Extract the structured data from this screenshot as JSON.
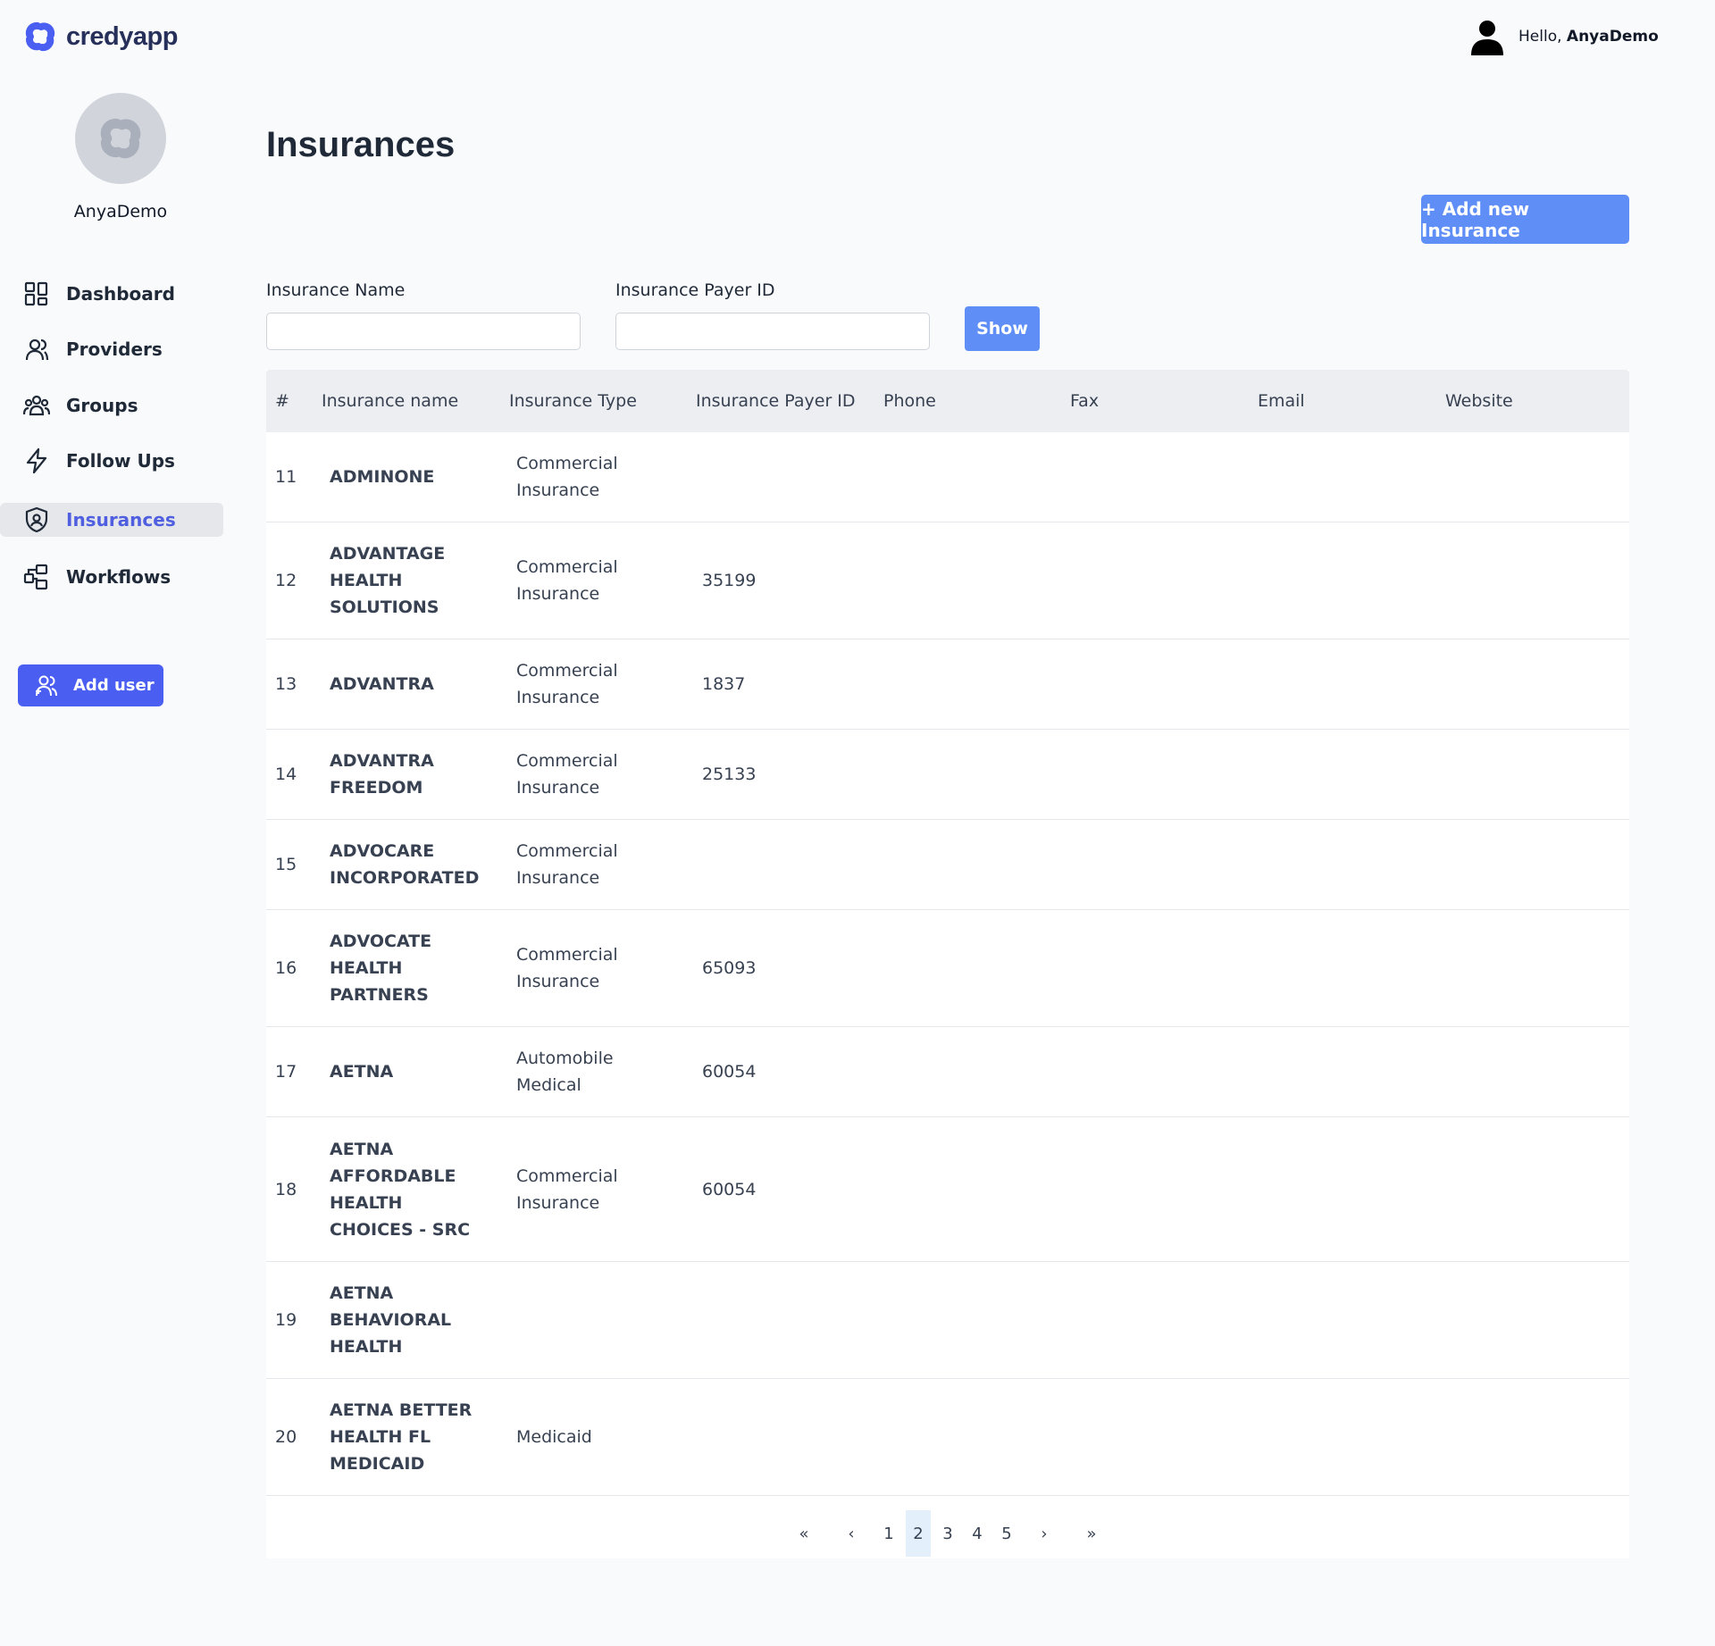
{
  "brand": {
    "name": "credyapp",
    "color": "#4a5ff2"
  },
  "top_user": {
    "greeting": "Hello,",
    "name": "AnyaDemo"
  },
  "profile": {
    "username": "AnyaDemo"
  },
  "nav": {
    "items": [
      {
        "label": "Dashboard",
        "icon": "dashboard-grid-icon",
        "active": false
      },
      {
        "label": "Providers",
        "icon": "user-icon",
        "active": false
      },
      {
        "label": "Groups",
        "icon": "group-icon",
        "active": false
      },
      {
        "label": "Follow Ups",
        "icon": "lightning-icon",
        "active": false
      },
      {
        "label": "Insurances",
        "icon": "shield-user-icon",
        "active": true
      },
      {
        "label": "Workflows",
        "icon": "workflow-icon",
        "active": false
      }
    ],
    "add_user_label": "Add user"
  },
  "page": {
    "title": "Insurances",
    "add_new_label": "+ Add new Insurance"
  },
  "filters": {
    "name_label": "Insurance Name",
    "name_value": "",
    "payer_label": "Insurance Payer ID",
    "payer_value": "",
    "show_label": "Show"
  },
  "table": {
    "columns": [
      "#",
      "Insurance name",
      "Insurance Type",
      "Insurance Payer ID",
      "Phone",
      "Fax",
      "Email",
      "Website"
    ],
    "rows": [
      {
        "num": "11",
        "name": "ADMINONE",
        "type": "Commercial Insurance",
        "payer": ""
      },
      {
        "num": "12",
        "name": "ADVANTAGE HEALTH SOLUTIONS",
        "type": "Commercial Insurance",
        "payer": "35199"
      },
      {
        "num": "13",
        "name": "ADVANTRA",
        "type": "Commercial Insurance",
        "payer": "1837"
      },
      {
        "num": "14",
        "name": "ADVANTRA FREEDOM",
        "type": "Commercial Insurance",
        "payer": "25133"
      },
      {
        "num": "15",
        "name": "ADVOCARE INCORPORATED",
        "type": "Commercial Insurance",
        "payer": ""
      },
      {
        "num": "16",
        "name": "ADVOCATE HEALTH PARTNERS",
        "type": "Commercial Insurance",
        "payer": "65093"
      },
      {
        "num": "17",
        "name": "AETNA",
        "type": "Automobile Medical",
        "payer": "60054"
      },
      {
        "num": "18",
        "name": "AETNA AFFORDABLE HEALTH CHOICES - SRC",
        "type": "Commercial Insurance",
        "payer": "60054"
      },
      {
        "num": "19",
        "name": "AETNA BEHAVIORAL HEALTH",
        "type": "",
        "payer": ""
      },
      {
        "num": "20",
        "name": "AETNA BETTER HEALTH FL MEDICAID",
        "type": "Medicaid",
        "payer": ""
      }
    ]
  },
  "pagination": {
    "first": "«",
    "prev": "‹",
    "next": "›",
    "last": "»",
    "pages": [
      "1",
      "2",
      "3",
      "4",
      "5"
    ],
    "current": "2"
  }
}
